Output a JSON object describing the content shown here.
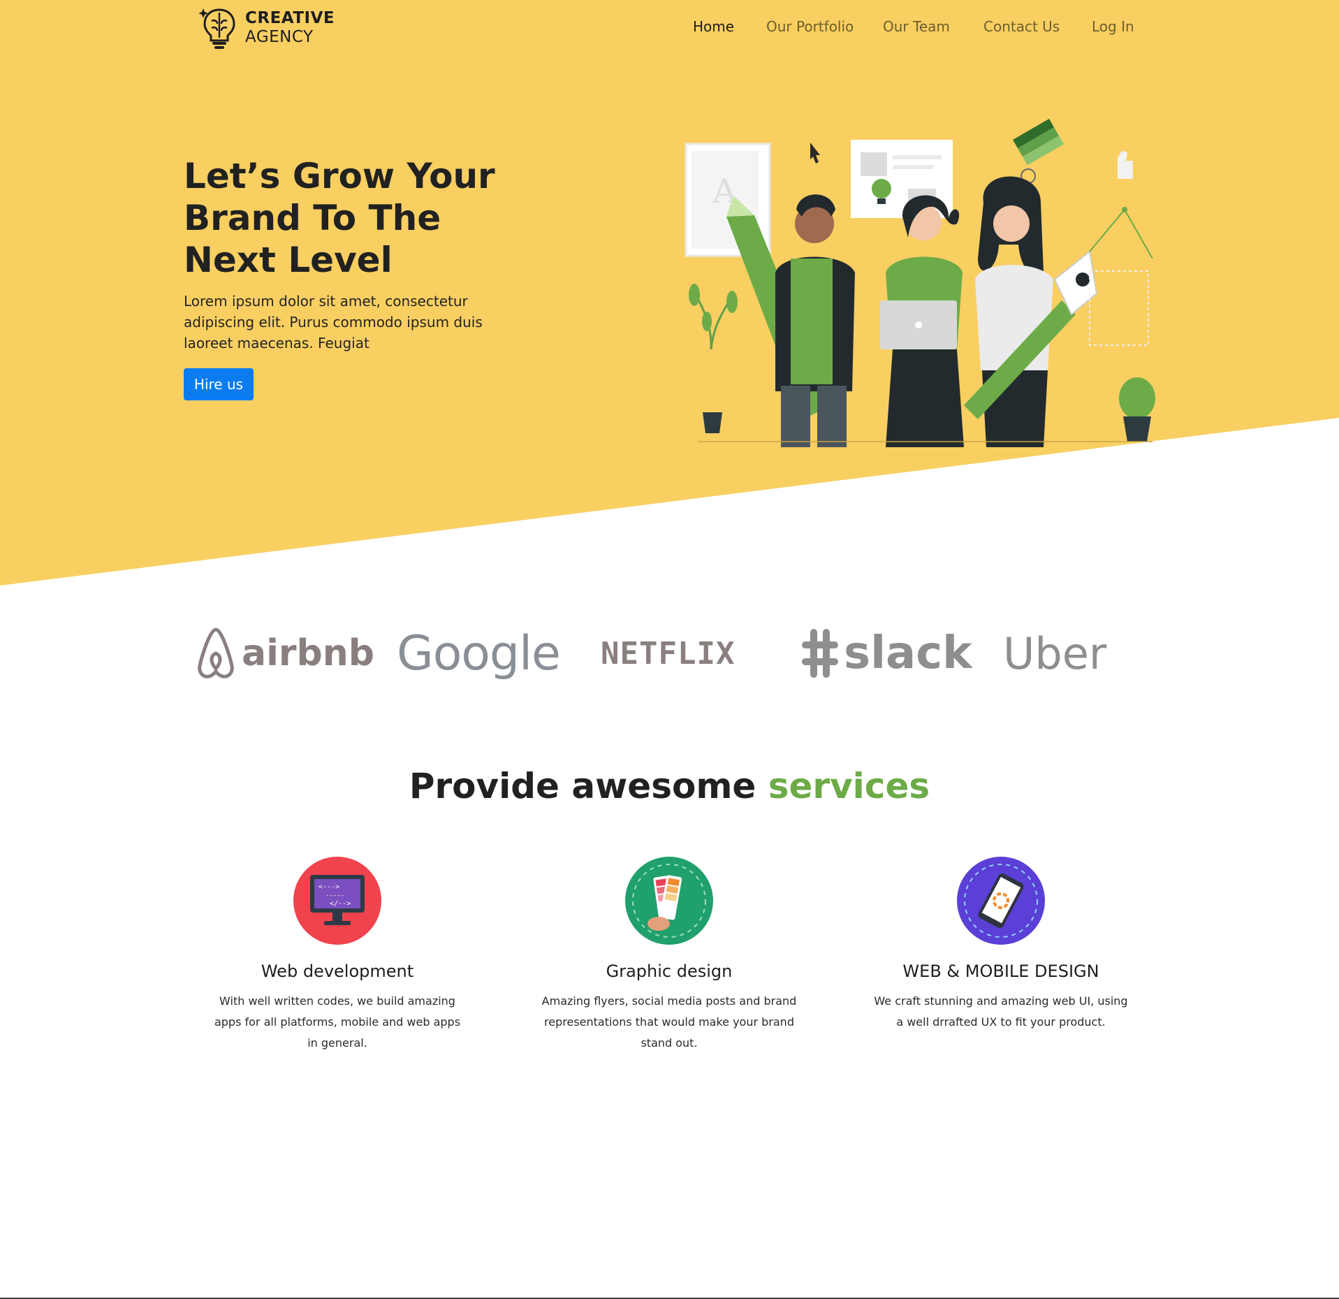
{
  "colors": {
    "hero_bg": "#f9cf62",
    "accent_green": "#6cab47",
    "button_blue": "#0a7cf0"
  },
  "brand": {
    "line1": "CREATIVE",
    "line2": "AGENCY",
    "icon": "brain-bulb-icon"
  },
  "nav": {
    "items": [
      {
        "label": "Home",
        "active": true
      },
      {
        "label": "Our Portfolio"
      },
      {
        "label": "Our Team"
      },
      {
        "label": "Contact Us"
      },
      {
        "label": "Log In"
      }
    ]
  },
  "hero": {
    "title": "Let’s Grow Your Brand To The Next Level",
    "description": "Lorem ipsum dolor sit amet, consectetur adipiscing elit. Purus commodo ipsum duis laoreet maecenas. Feugiat",
    "button_label": "Hire us",
    "illustration": "team-illustration"
  },
  "clients": [
    "airbnb",
    "Google",
    "NETFLIX",
    "slack",
    "Uber"
  ],
  "services": {
    "title_main": "Provide awesome ",
    "title_accent": "services",
    "items": [
      {
        "title": "Web development",
        "description": "With well written codes, we build amazing apps for all platforms, mobile and web apps in general.",
        "icon": "monitor-code-icon"
      },
      {
        "title": "Graphic design",
        "description": "Amazing flyers, social media posts and brand representations that would make your brand stand out.",
        "icon": "color-palette-icon"
      },
      {
        "title": "WEB & MOBILE DESIGN",
        "description": "We craft stunning and amazing web UI, using a well drrafted UX to fit your product.",
        "icon": "mobile-phone-icon"
      }
    ]
  }
}
